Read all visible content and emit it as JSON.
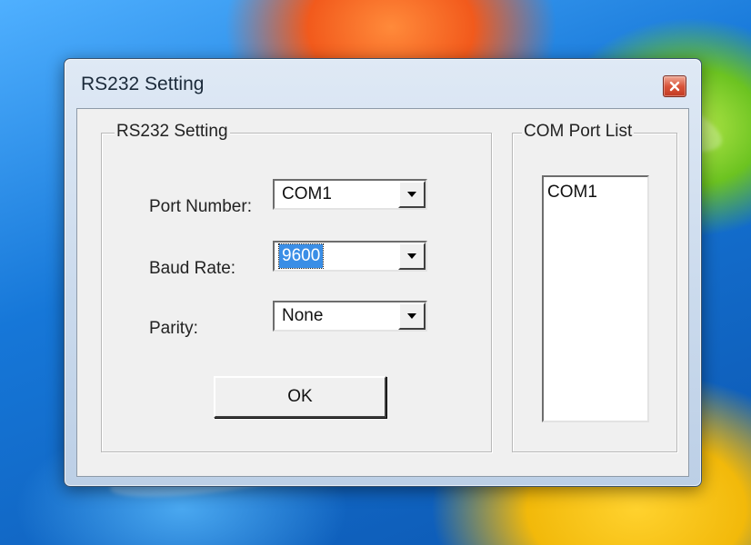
{
  "window": {
    "title": "RS232 Setting",
    "close_icon": "close-icon"
  },
  "settings_group": {
    "legend": "RS232 Setting",
    "port_number": {
      "label": "Port Number:",
      "value": "COM1"
    },
    "baud_rate": {
      "label": "Baud Rate:",
      "value": "9600"
    },
    "parity": {
      "label": "Parity:",
      "value": "None"
    },
    "ok_label": "OK"
  },
  "com_port_list": {
    "legend": "COM Port List",
    "items": [
      "COM1"
    ]
  },
  "colors": {
    "selection": "#3a8ee6",
    "close_button": "#d9543a",
    "dialog_face": "#f0f0f0"
  }
}
